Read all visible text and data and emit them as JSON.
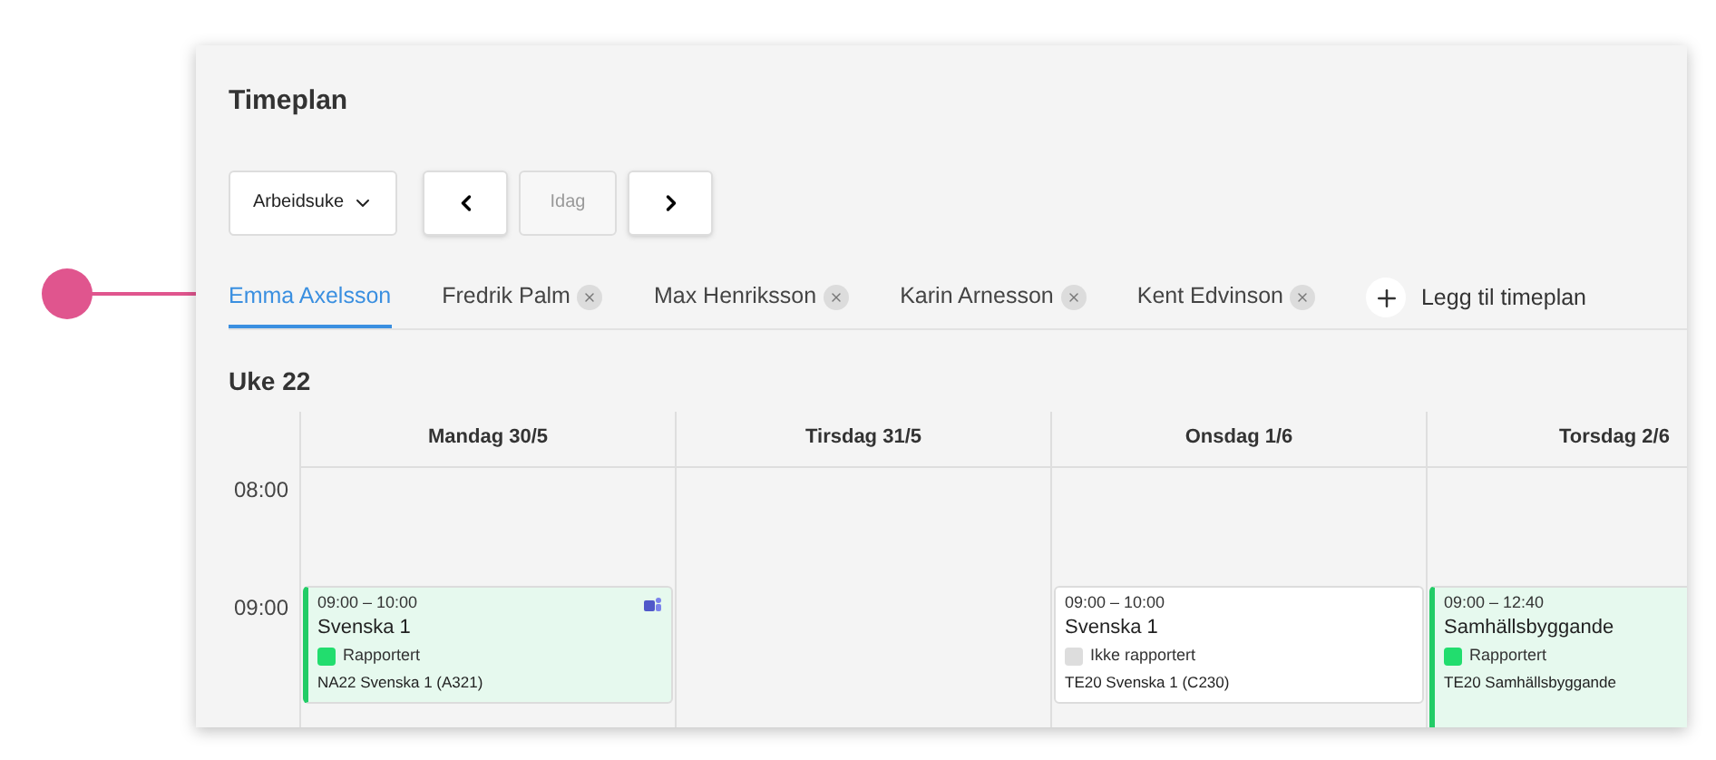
{
  "title": "Timeplan",
  "toolbar": {
    "view_select": "Arbeidsuke",
    "today_button": "Idag"
  },
  "tabs": [
    {
      "label": "Emma Axelsson",
      "selected": true,
      "removable": false
    },
    {
      "label": "Fredrik Palm",
      "selected": false,
      "removable": true
    },
    {
      "label": "Max Henriksson",
      "selected": false,
      "removable": true
    },
    {
      "label": "Karin Arnesson",
      "selected": false,
      "removable": true
    },
    {
      "label": "Kent Edvinson",
      "selected": false,
      "removable": true
    }
  ],
  "add_tab": "Legg til timeplan",
  "week": "Uke 22",
  "hours": [
    "08:00",
    "09:00"
  ],
  "days": [
    {
      "label": "Mandag 30/5",
      "events": [
        {
          "time": "09:00 – 10:00",
          "title": "Svenska 1",
          "reported": true,
          "status": "Rapportert",
          "group": "NA22 Svenska 1 (A321)",
          "online_meeting": true,
          "continues_below": false
        }
      ]
    },
    {
      "label": "Tirsdag 31/5"
    },
    {
      "label": "Onsdag 1/6",
      "events": [
        {
          "time": "09:00 – 10:00",
          "title": "Svenska 1",
          "reported": false,
          "status": "Ikke rapportert",
          "group": "TE20 Svenska 1 (C230)",
          "online_meeting": false,
          "continues_below": false
        }
      ]
    },
    {
      "label": "Torsdag 2/6",
      "events": [
        {
          "time": "09:00 – 12:40",
          "title": "Samhällsbyggande",
          "reported": true,
          "status": "Rapportert",
          "group": "TE20 Samhällsbyggande",
          "online_meeting": false,
          "continues_below": true
        }
      ]
    }
  ]
}
